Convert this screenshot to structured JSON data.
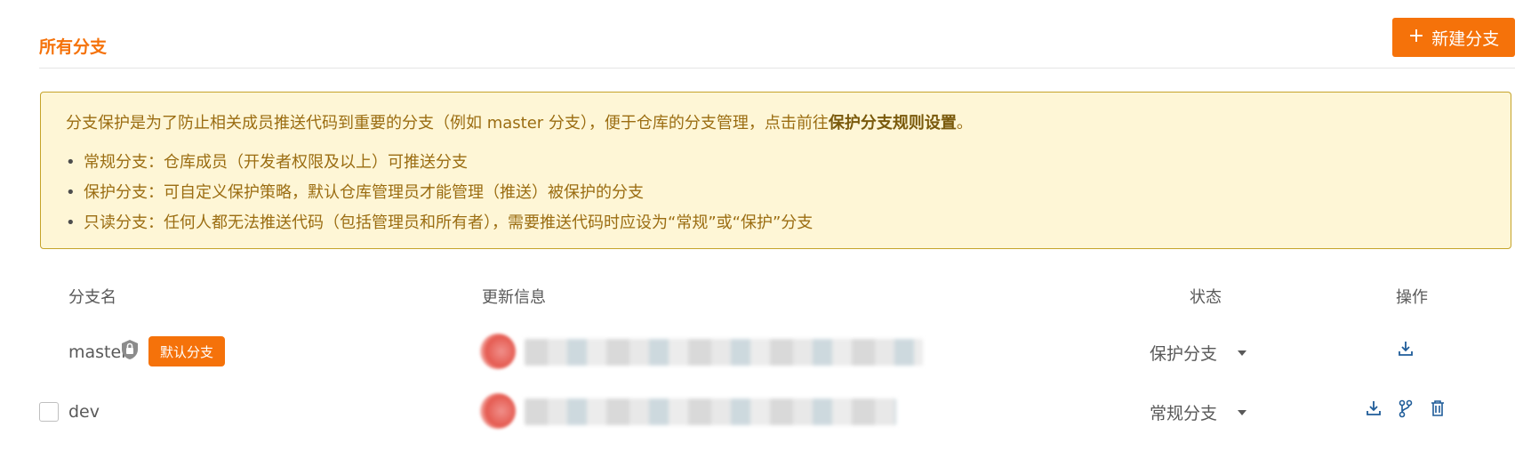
{
  "header": {
    "title": "所有分支",
    "new_branch_label": "新建分支"
  },
  "notice": {
    "intro_text": "分支保护是为了防止相关成员推送代码到重要的分支（例如 master 分支），便于仓库的分支管理，点击前往",
    "intro_link": "保护分支规则设置",
    "intro_end": "。",
    "items": [
      "常规分支：仓库成员（开发者权限及以上）可推送分支",
      "保护分支：可自定义保护策略，默认仓库管理员才能管理（推送）被保护的分支",
      "只读分支：任何人都无法推送代码（包括管理员和所有者），需要推送代码时应设为“常规”或“保护”分支"
    ]
  },
  "table": {
    "columns": [
      "分支名",
      "更新信息",
      "状态",
      "操作"
    ],
    "rows": [
      {
        "name": "master",
        "badge": "默认分支",
        "status": "保护分支",
        "icons": [
          "lock-icon",
          "download-icon"
        ]
      },
      {
        "name": "dev",
        "status": "常规分支",
        "icons": [
          "download-icon",
          "git-branch-icon",
          "trash-icon"
        ]
      }
    ]
  },
  "colors": {
    "accent": "#f5720a",
    "notice_bg": "#fef6d6",
    "notice_border": "#c5a32a",
    "notice_text": "#9b6d12"
  }
}
